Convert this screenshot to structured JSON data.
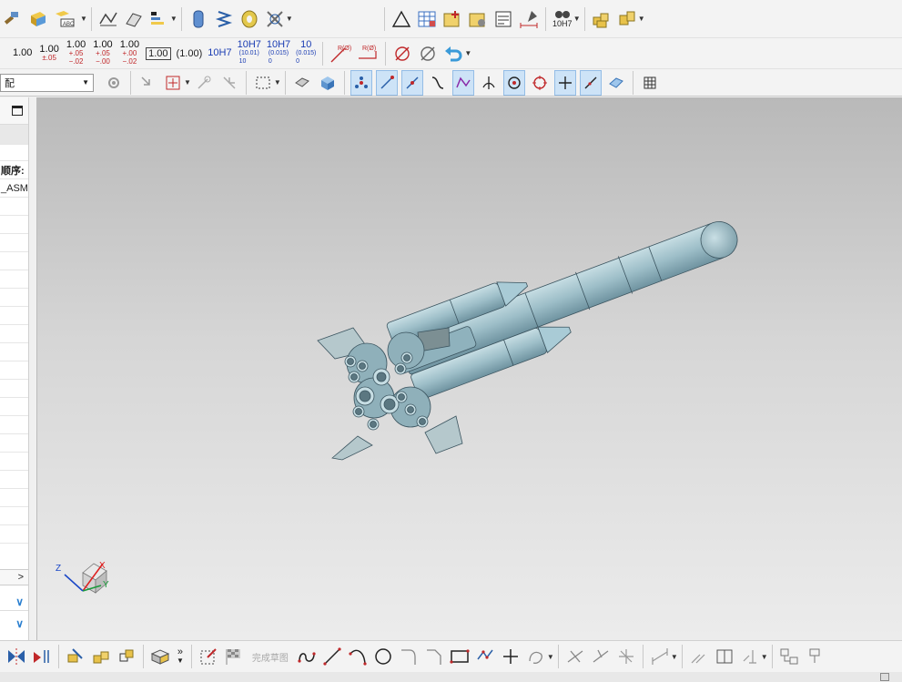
{
  "toolbar_row2": {
    "tolerances": [
      {
        "nominal": "1.00",
        "tol": ""
      },
      {
        "nominal": "1.00",
        "tol": "±.05"
      },
      {
        "nominal": "1.00",
        "tol": "+.05\n−.02"
      },
      {
        "nominal": "1.00",
        "tol": "+.05\n−.00"
      },
      {
        "nominal": "1.00",
        "tol": "+.00\n−.02"
      }
    ],
    "boxed_value": "1.00",
    "paren_value": "(1.00)",
    "fit_plain": "10H7",
    "fit_a": {
      "main": "10H7",
      "sub": "(10.01)\n10"
    },
    "fit_b": {
      "main": "10H7",
      "sub": "(0.015)\n0"
    },
    "fit_c": {
      "main": "10",
      "sub": "(0.015)\n0"
    },
    "radius_a": "R(Ø)",
    "radius_b": "R(Ø)"
  },
  "toolbar_row1": {
    "fit_label": "10H7"
  },
  "toolbar_row3": {
    "assembly_select_value": "配"
  },
  "left_panel": {
    "rows": [
      "",
      "",
      "顺序:",
      "_ASM",
      "",
      "",
      "",
      "",
      "",
      "",
      "",
      "",
      "",
      "",
      "",
      "",
      "",
      "",
      "",
      "",
      "",
      "",
      "",
      ""
    ],
    "chevron_right": ">",
    "chevron_down_1": "∨",
    "chevron_down_2": "∨"
  },
  "axis_triad": {
    "x": "X",
    "y": "Y",
    "z": "Z"
  },
  "bottom_bar": {
    "finish_sketch_label": "完成草图",
    "more": "»"
  },
  "colors": {
    "rocket_fill": "#a8c6cf",
    "rocket_shade": "#7d9ea8",
    "fin_fill": "#b9c9cc",
    "viewport_top": "#b9b9b9",
    "viewport_bottom": "#ececec"
  }
}
